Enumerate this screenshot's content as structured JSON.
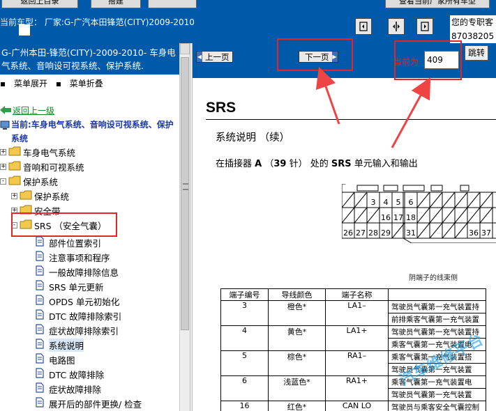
{
  "top": {
    "buttons": [
      "返回上目录",
      "搭建",
      "查看当前厂家所有车型"
    ],
    "current_model_label": "当前车型：",
    "current_model_value": "厂家:G-广汽本田锋范(CITY)2009-2010",
    "info_line1": "您的专职客",
    "info_line2": "87038205"
  },
  "left": {
    "title": "G-广州本田-锋范(CITY)-2009-2010- 车身电气系统、音响设可视系统、保护系统.",
    "expand": "菜单展开",
    "collapse": "菜单折叠",
    "back": "返回上一级",
    "current": "当前:车身电气系统、音响设可视系统、保护系统",
    "tree": [
      {
        "label": "车身电气系统",
        "pm": "+"
      },
      {
        "label": "音响和可视系统",
        "pm": "+"
      },
      {
        "label": "保护系统",
        "pm": "-"
      },
      {
        "label": "保护系统",
        "pm": "+"
      },
      {
        "label": "安全带",
        "pm": "+"
      },
      {
        "label": "SRS （安全气囊）",
        "pm": "-"
      }
    ],
    "docs": [
      "部件位置索引",
      "注意事项和程序",
      "一般故障排除信息",
      "SRS 单元更新",
      "OPDS 单元初始化",
      "DTC 故障排除索引",
      "症状故障排除索引",
      "系统说明",
      "电路图",
      "DTC 故障排除",
      "症状故障排除",
      "展开后的部件更换/ 检查"
    ]
  },
  "pager": {
    "prev": "上一页",
    "next": "下一页",
    "current_label": "当前为",
    "current_value": "409",
    "jump": "跳转"
  },
  "doc": {
    "heading": "SRS",
    "subheading": "系统说明 （续）",
    "para_pre": "在插接器 ",
    "para_a": "A",
    "para_mid": " （",
    "para_39": "39",
    "para_mid2": " 针） 处的 ",
    "para_srs": "SRS",
    "para_post": " 单元输入和输出",
    "connector_caption": "阴端子的线束侧",
    "pins_row1": [
      "3",
      "4",
      "5",
      "6"
    ],
    "pins_row2": [
      "16",
      "17",
      "18"
    ],
    "pins_row3": [
      "26",
      "27",
      "28",
      "29",
      "31",
      "36",
      "37"
    ],
    "table_headers": [
      "端子编号",
      "导线颜色",
      "端子名称"
    ],
    "rows": [
      {
        "n": "3",
        "color": "橙色*",
        "name": "LA1–",
        "desc": [
          "驾驶员气囊第一充气装置持",
          "前排乘客气囊第一充气装置"
        ]
      },
      {
        "n": "4",
        "color": "黄色*",
        "name": "LA1+",
        "desc": [
          "驾驶员气囊第一充气装置持",
          "乘客气囊第一充气装置电"
        ]
      },
      {
        "n": "5",
        "color": "棕色*",
        "name": "RA1–",
        "desc": [
          "乘客气囊第一充气装置搭",
          "驾驶员气囊第一充气装置"
        ]
      },
      {
        "n": "6",
        "color": "浅蓝色*",
        "name": "RA1+",
        "desc": [
          "乘客气囊第一充气装置电",
          "驾驶员气囊第一充气装置"
        ]
      },
      {
        "n": "16",
        "color": "红色*",
        "name": "CAN LO",
        "desc": [
          "驾驶员与乘客安全气囊控制"
        ]
      }
    ],
    "watermark": "汽车维修平台"
  }
}
